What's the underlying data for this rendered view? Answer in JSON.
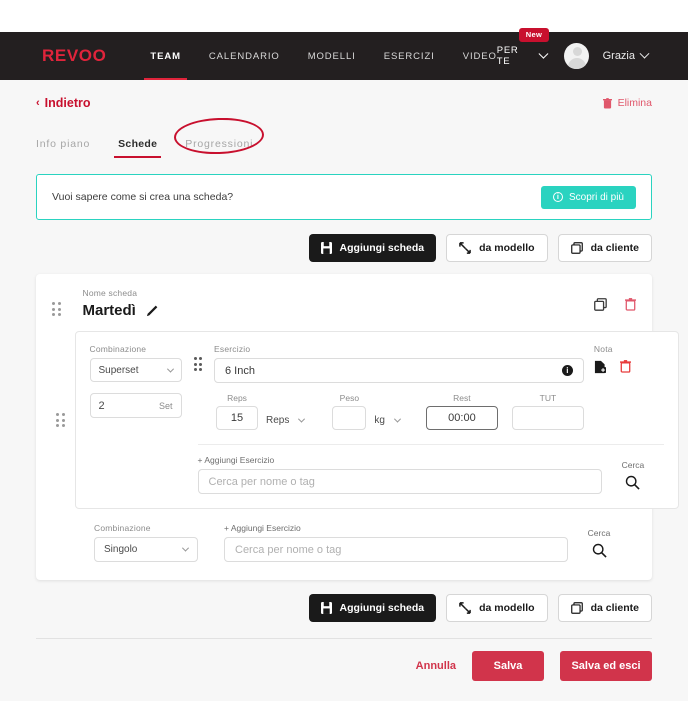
{
  "navbar": {
    "logo": "REVOO",
    "links": [
      {
        "label": "TEAM",
        "active": true
      },
      {
        "label": "CALENDARIO",
        "active": false
      },
      {
        "label": "MODELLI",
        "active": false
      },
      {
        "label": "ESERCIZI",
        "active": false
      },
      {
        "label": "VIDEO",
        "active": false
      }
    ],
    "per_te": "PER TE",
    "new_badge": "New",
    "username": "Grazia"
  },
  "header": {
    "back_label": "Indietro",
    "back_arrow": "‹",
    "delete_label": "Elimina"
  },
  "tabs": [
    {
      "label": "Info piano",
      "active": false
    },
    {
      "label": "Schede",
      "active": true
    },
    {
      "label": "Progressioni",
      "active": false,
      "annotated": true
    }
  ],
  "banner": {
    "text": "Vuoi sapere come si crea una scheda?",
    "button_label": "Scopri di più",
    "info_glyph": "i",
    "border_color": "#2ad3c0",
    "button_color": "#2ad3c0"
  },
  "actions": {
    "add_card": "Aggiungi scheda",
    "from_template": "da modello",
    "from_client": "da cliente"
  },
  "card": {
    "name_label": "Nome scheda",
    "name_value": "Martedì"
  },
  "exercise": {
    "combination_label": "Combinazione",
    "combination_value": "Superset",
    "set_value": "2",
    "set_label": "Set",
    "exercise_label": "Esercizio",
    "exercise_value": "6 Inch",
    "note_label": "Nota",
    "metrics": [
      {
        "label": "Reps",
        "value": "15",
        "unit": "Reps",
        "has_unit_dropdown": true,
        "highlighted": false
      },
      {
        "label": "Peso",
        "value": "",
        "unit": "kg",
        "has_unit_dropdown": true,
        "highlighted": false
      },
      {
        "label": "Rest",
        "value": "00:00",
        "unit": "",
        "has_unit_dropdown": false,
        "highlighted": true
      },
      {
        "label": "TUT",
        "value": "",
        "unit": "",
        "has_unit_dropdown": false,
        "highlighted": false
      }
    ],
    "add_exercise_label": "+ Aggiungi Esercizio",
    "search_placeholder": "Cerca per nome o tag",
    "search_label": "Cerca"
  },
  "new_block": {
    "combination_label": "Combinazione",
    "combination_value": "Singolo",
    "add_exercise_label": "+ Aggiungi Esercizio",
    "search_placeholder": "Cerca per nome o tag",
    "search_label": "Cerca"
  },
  "footer": {
    "cancel": "Annulla",
    "save": "Salva",
    "save_exit": "Salva ed esci",
    "red": "#d1344b"
  }
}
